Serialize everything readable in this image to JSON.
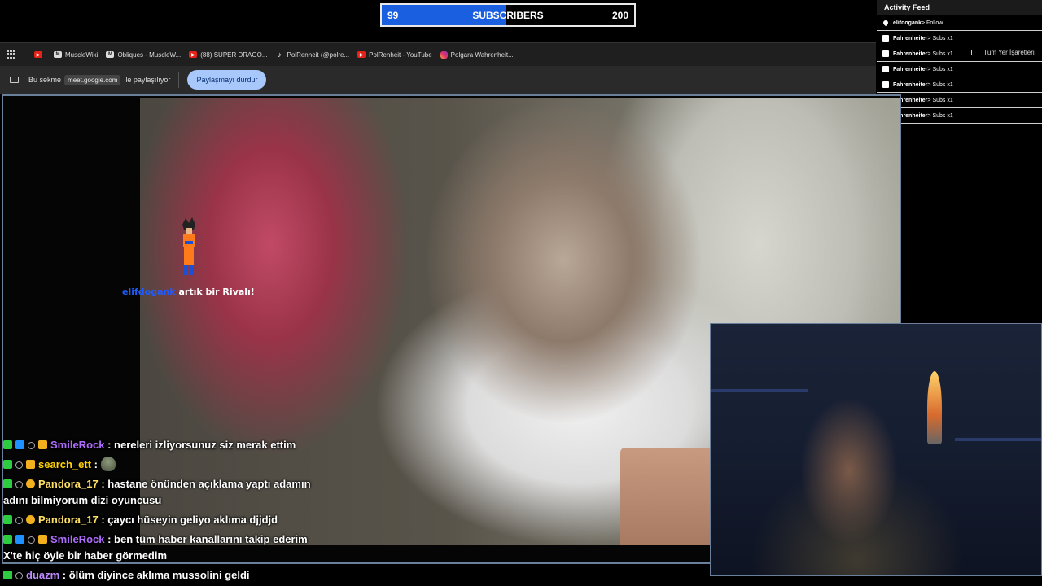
{
  "sub_goal": {
    "current": "99",
    "title": "SUBSCRIBERS",
    "target": "200",
    "progress_fraction": 0.495,
    "fill_color": "#1a5fe0"
  },
  "bookmarks": {
    "apps_icon": "apps-grid-icon",
    "items": [
      {
        "icon": "youtube-icon",
        "label": ""
      },
      {
        "icon": "musclewiki-icon",
        "label": "MuscleWiki"
      },
      {
        "icon": "musclewiki-icon",
        "label": "Obliques - MuscleW..."
      },
      {
        "icon": "youtube-icon",
        "label": "(88) SUPER DRAGO..."
      },
      {
        "icon": "tiktok-icon",
        "label": "PolRenheit (@polre..."
      },
      {
        "icon": "youtube-icon",
        "label": "PolRenheit - YouTube"
      },
      {
        "icon": "instagram-icon",
        "label": "Polgara Wahrenheit..."
      }
    ]
  },
  "share_bar": {
    "prefix": "Bu sekme",
    "domain": "meet.google.com",
    "suffix": "ile paylaşılıyor",
    "stop_label": "Paylaşmayı durdur"
  },
  "activity_feed": {
    "title": "Activity Feed",
    "items": [
      {
        "icon": "heart-icon",
        "user": "elifdogank",
        "action": " > Follow"
      },
      {
        "icon": "gift-icon",
        "user": "Fahrenheiter",
        "action": " > Subs x1"
      },
      {
        "icon": "gift-icon",
        "user": "Fahrenheiter",
        "action": " > Subs x1"
      },
      {
        "icon": "gift-icon",
        "user": "Fahrenheiter",
        "action": " > Subs x1"
      },
      {
        "icon": "gift-icon",
        "user": "Fahrenheiter",
        "action": " > Subs x1"
      },
      {
        "icon": "gift-icon",
        "user": "Fahrenheiter",
        "action": " > Subs x1"
      },
      {
        "icon": "gift-icon",
        "user": "Fahrenheiter",
        "action": " > Subs x1"
      }
    ]
  },
  "markers": {
    "icon": "folder-icon",
    "label": "Tüm Yer İşaretleri"
  },
  "rival_alert": {
    "user": "elifdogank",
    "text": " artık bir Rivalı!"
  },
  "chat": [
    {
      "badges": [
        "green",
        "blue",
        "vip",
        "crown"
      ],
      "user": "SmileRock",
      "color": "#b06cff",
      "sep": " : ",
      "message": "nereleri izliyorsunuz siz merak ettim"
    },
    {
      "badges": [
        "green",
        "vip",
        "crown"
      ],
      "user": "search_ett",
      "color": "#ffd200",
      "sep": " : ",
      "message": "",
      "emote": "emote-icon"
    },
    {
      "badges": [
        "green",
        "vip",
        "warn"
      ],
      "user": "Pandora_17",
      "color": "#ffe066",
      "sep": " : ",
      "message": "hastane önünden açıklama yaptı adamın adını bilmiyorum dizi oyuncusu"
    },
    {
      "badges": [
        "green",
        "vip",
        "warn"
      ],
      "user": "Pandora_17",
      "color": "#ffe066",
      "sep": " : ",
      "message": "çaycı hüseyin geliyo aklıma djjdjd"
    },
    {
      "badges": [
        "green",
        "blue",
        "vip",
        "crown"
      ],
      "user": "SmileRock",
      "color": "#b06cff",
      "sep": " : ",
      "message": "ben tüm haber kanallarını takip ederim X'te hiç öyle bir haber görmedim"
    },
    {
      "badges": [
        "green",
        "vip"
      ],
      "user": "duazm",
      "color": "#c08cff",
      "sep": " : ",
      "message": "ölüm diyince aklıma mussolini geldi"
    }
  ]
}
